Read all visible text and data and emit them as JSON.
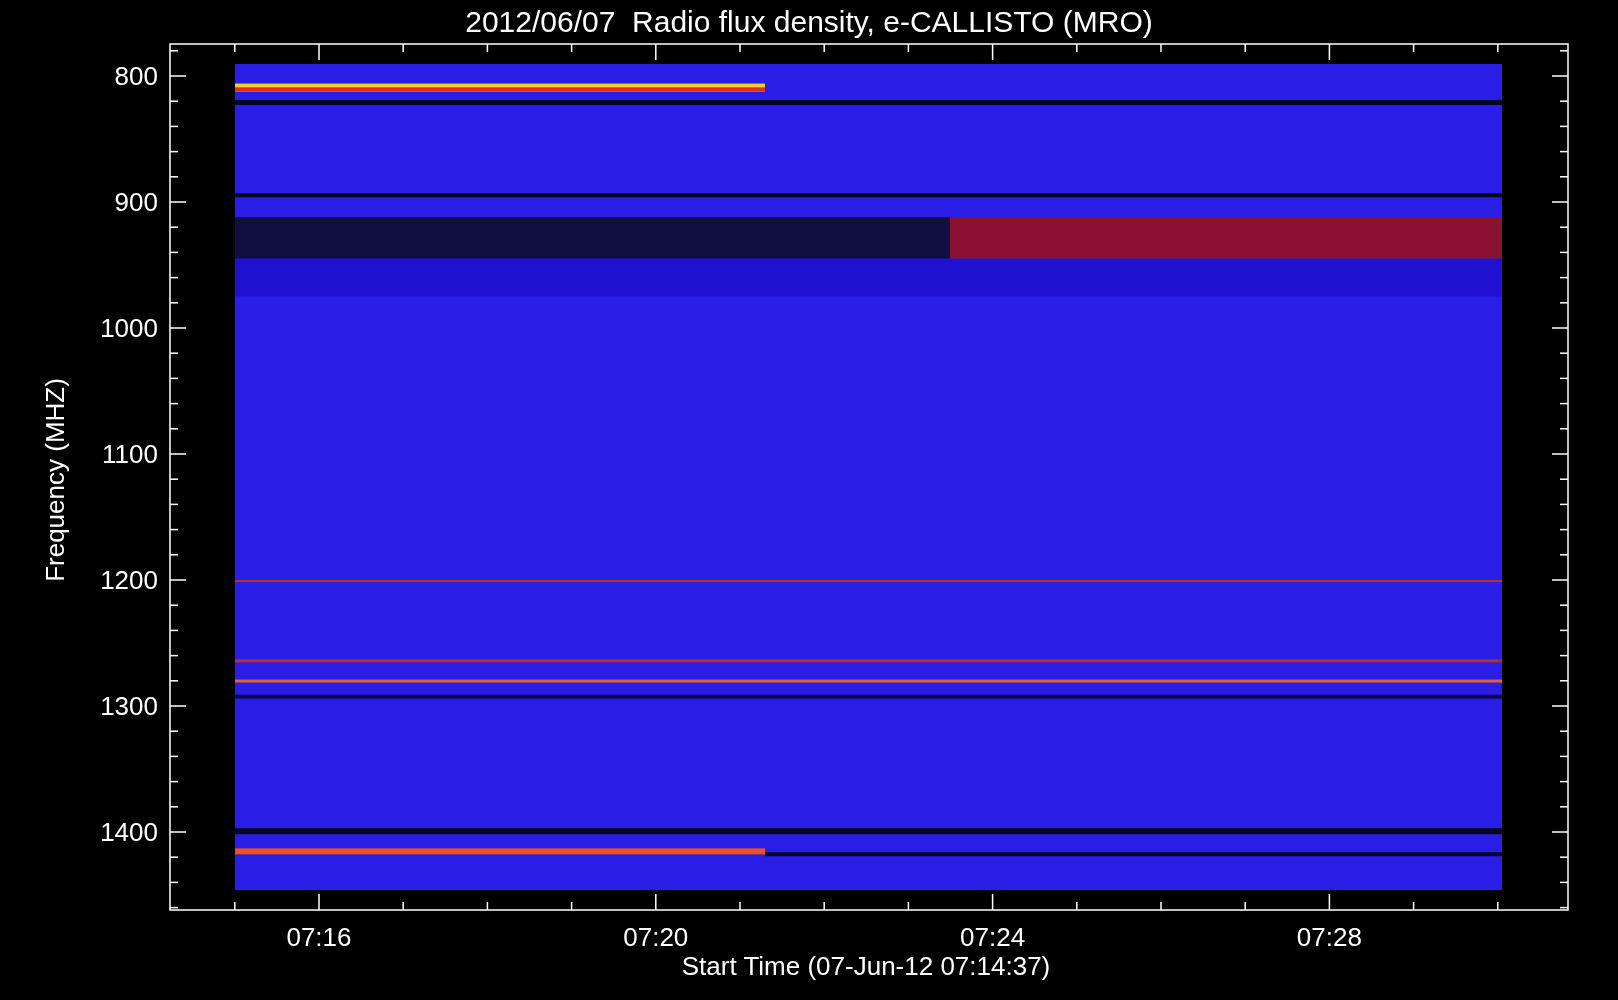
{
  "title": "2012/06/07  Radio flux density, e-CALLISTO (MRO)",
  "y_axis": {
    "label": "Frequency (MHZ)",
    "ticks": [
      "800",
      "900",
      "1000",
      "1100",
      "1200",
      "1300",
      "1400"
    ]
  },
  "x_axis": {
    "label": "Start Time (07-Jun-12 07:14:37)",
    "ticks": [
      "07:16",
      "07:20",
      "07:24",
      "07:28"
    ]
  }
}
